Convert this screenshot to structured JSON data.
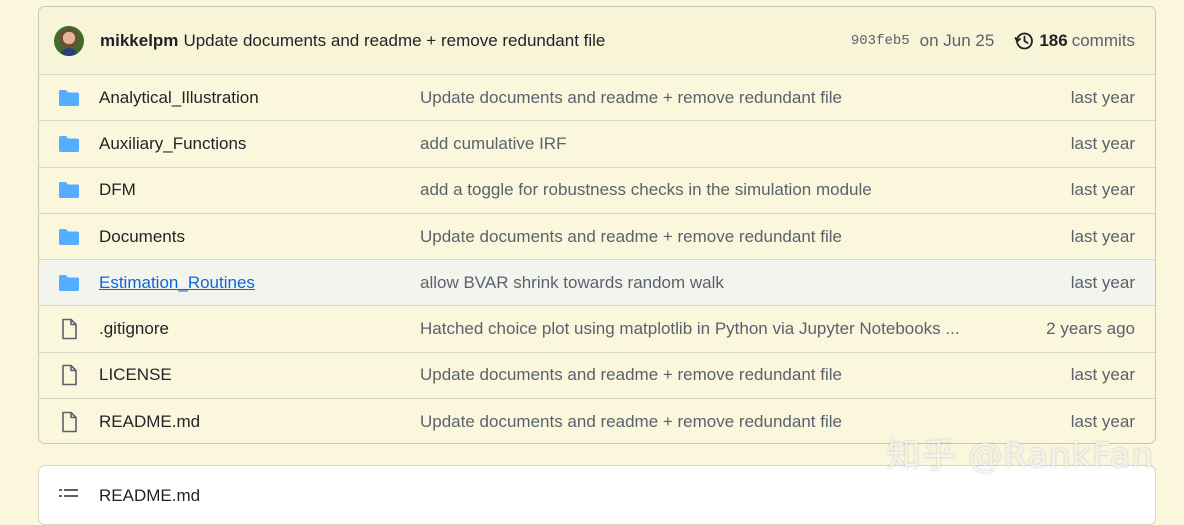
{
  "commit": {
    "author": "mikkelpm",
    "message": "Update documents and readme + remove redundant file",
    "sha": "903feb5",
    "date": "on Jun 25",
    "commit_count": "186",
    "commit_label": "commits"
  },
  "files": [
    {
      "type": "folder",
      "name": "Analytical_Illustration",
      "message": "Update documents and readme + remove redundant file",
      "date": "last year"
    },
    {
      "type": "folder",
      "name": "Auxiliary_Functions",
      "message": "add cumulative IRF",
      "date": "last year"
    },
    {
      "type": "folder",
      "name": "DFM",
      "message": "add a toggle for robustness checks in the simulation module",
      "date": "last year"
    },
    {
      "type": "folder",
      "name": "Documents",
      "message": "Update documents and readme + remove redundant file",
      "date": "last year"
    },
    {
      "type": "folder",
      "name": "Estimation_Routines",
      "message": "allow BVAR shrink towards random walk",
      "date": "last year"
    },
    {
      "type": "file",
      "name": ".gitignore",
      "message": "Hatched choice plot using matplotlib in Python via Jupyter Notebooks ...",
      "date": "2 years ago"
    },
    {
      "type": "file",
      "name": "LICENSE",
      "message": "Update documents and readme + remove redundant file",
      "date": "last year"
    },
    {
      "type": "file",
      "name": "README.md",
      "message": "Update documents and readme + remove redundant file",
      "date": "last year"
    }
  ],
  "readme": {
    "title": "README.md"
  },
  "watermark": "知乎 @RankFan",
  "colors": {
    "folder": "#54aeff",
    "link": "#0969da",
    "background": "#fbf7dc"
  }
}
